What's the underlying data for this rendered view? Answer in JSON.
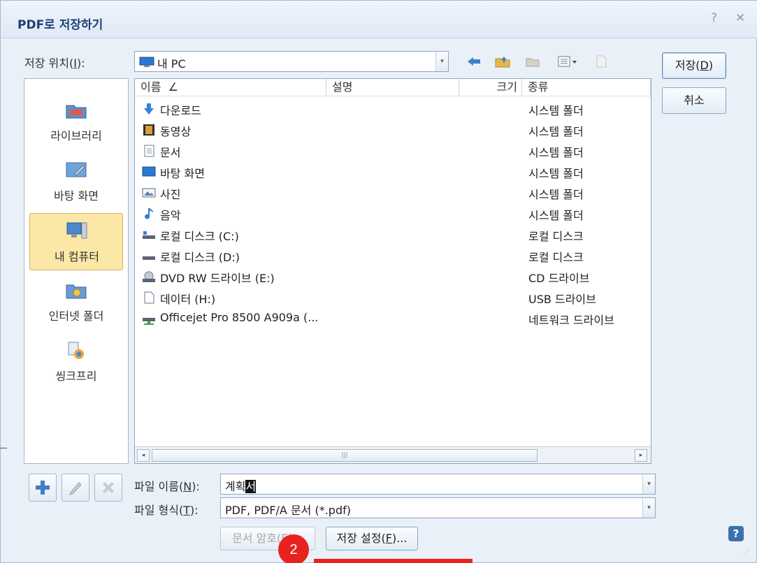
{
  "window": {
    "title": "PDF로 저장하기",
    "help_glyph": "?",
    "close_glyph": "✕"
  },
  "location": {
    "label": "저장 위치(",
    "label_key": "I",
    "label_end": "):",
    "value": "내 PC"
  },
  "toolbar": {
    "icons": [
      "back-icon",
      "up-folder-icon",
      "new-folder-icon",
      "view-menu-icon",
      "properties-icon"
    ]
  },
  "buttons": {
    "save": "저장(",
    "save_key": "D",
    "save_end": ")",
    "cancel": "취소"
  },
  "places": [
    {
      "label": "라이브러리",
      "icon": "library-icon"
    },
    {
      "label": "바탕 화면",
      "icon": "desktop-icon"
    },
    {
      "label": "내 컴퓨터",
      "icon": "my-computer-icon",
      "selected": true
    },
    {
      "label": "인터넷 폴더",
      "icon": "internet-folder-icon"
    },
    {
      "label": "씽크프리",
      "icon": "thinkfree-icon"
    }
  ],
  "columns": {
    "name": "이름",
    "sort_glyph": "∠",
    "desc": "설명",
    "size": "크기",
    "type": "종류"
  },
  "files": [
    {
      "name": "다운로드",
      "type": "시스템 폴더",
      "icon": "download-icon"
    },
    {
      "name": "동영상",
      "type": "시스템 폴더",
      "icon": "video-icon"
    },
    {
      "name": "문서",
      "type": "시스템 폴더",
      "icon": "document-icon"
    },
    {
      "name": "바탕 화면",
      "type": "시스템 폴더",
      "icon": "desktop-folder-icon"
    },
    {
      "name": "사진",
      "type": "시스템 폴더",
      "icon": "picture-icon"
    },
    {
      "name": "음악",
      "type": "시스템 폴더",
      "icon": "music-icon"
    },
    {
      "name": "로컬 디스크 (C:)",
      "type": "로컬 디스크",
      "icon": "local-disk-icon"
    },
    {
      "name": "로컬 디스크 (D:)",
      "type": "로컬 디스크",
      "icon": "local-disk-icon"
    },
    {
      "name": "DVD RW 드라이브 (E:)",
      "type": "CD 드라이브",
      "icon": "dvd-drive-icon"
    },
    {
      "name": "데이터 (H:)",
      "type": "USB 드라이브",
      "icon": "usb-drive-icon"
    },
    {
      "name": "Officejet Pro 8500 A909a (...",
      "type": "네트워크 드라이브",
      "icon": "network-drive-icon"
    }
  ],
  "scroll": {
    "left": "◂",
    "right": "▸",
    "grip": "|||"
  },
  "filename": {
    "label": "파일 이름(",
    "label_key": "N",
    "label_end": "):",
    "value": "계획",
    "selected_char": "서"
  },
  "filetype": {
    "label": "파일 형식(",
    "label_key": "T",
    "label_end": "):",
    "value": "PDF, PDF/A 문서 (*.pdf)"
  },
  "bottom_buttons": {
    "password": "문서 암호(E)...",
    "settings": "저장 설정(",
    "settings_key": "F",
    "settings_end": ")..."
  },
  "badge": "2",
  "colors": {
    "accent": "#e8231f",
    "title": "#1f3f76",
    "selection": "#fbe7a6"
  }
}
